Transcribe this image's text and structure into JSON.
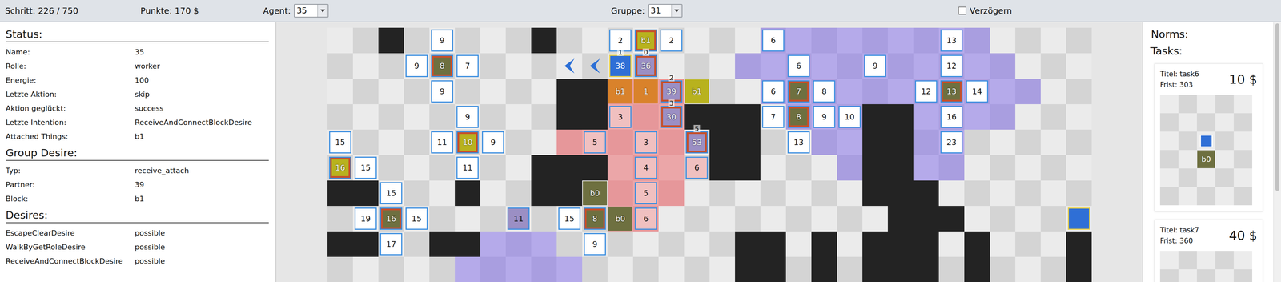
{
  "toolbar": {
    "step": "Schritt: 226 / 750",
    "points": "Punkte: 170 $",
    "agent_label": "Agent:",
    "agent_value": "35",
    "group_label": "Gruppe:",
    "group_value": "31",
    "delay": {
      "label": "Verzögern",
      "checked": false
    }
  },
  "status": {
    "title": "Status:",
    "rows": [
      {
        "label": "Name:",
        "value": "35"
      },
      {
        "label": "Rolle:",
        "value": "worker"
      },
      {
        "label": "Energie:",
        "value": "100"
      },
      {
        "label": "Letzte Aktion:",
        "value": "skip"
      },
      {
        "label": "Aktion geglückt:",
        "value": "success"
      },
      {
        "label": "Letzte Intention:",
        "value": "ReceiveAndConnectBlockDesire"
      },
      {
        "label": "Attached Things:",
        "value": "b1"
      }
    ]
  },
  "group_desire": {
    "title": "Group Desire:",
    "rows": [
      {
        "label": "Typ:",
        "value": "receive_attach"
      },
      {
        "label": "Partner:",
        "value": "39"
      },
      {
        "label": "Block:",
        "value": "b1"
      }
    ]
  },
  "desires": {
    "title": "Desires:",
    "rows": [
      {
        "label": "EscapeClearDesire",
        "value": "possible"
      },
      {
        "label": "WalkByGetRoleDesire",
        "value": "possible"
      },
      {
        "label": "ReceiveAndConnectBlockDesire",
        "value": "possible"
      }
    ]
  },
  "map": {
    "rows": [
      "..#.....#........ppppppppp....",
      "................ppppppppppp...",
      ".........##rrr...ppppppppppp..",
      ".........##rrr###.ppp##pppp...",
      ".........rrrrr.##..pp##pp.....",
      "........###rrr.##...p##pp.....",
      "##...#..##.rrr.......###......",
      "...........rr.........###.....",
      "##..##ppp.......##.#.###.#...#",
      ".....ppppp......##.#.###.#...#"
    ],
    "entities": [
      {
        "row": 0,
        "col": 4,
        "label": "9",
        "kind": "agent",
        "color": "#ffffff",
        "tag": ""
      },
      {
        "row": 0,
        "col": 11,
        "label": "2",
        "kind": "agent",
        "color": "#ffffff",
        "tag": ""
      },
      {
        "row": 0,
        "col": 12,
        "label": "b1",
        "kind": "carrier",
        "color": "#b8b21e",
        "tag": ""
      },
      {
        "row": 0,
        "col": 13,
        "label": "2",
        "kind": "agent",
        "color": "#ffffff",
        "tag": ""
      },
      {
        "row": 0,
        "col": 17,
        "label": "6",
        "kind": "agent",
        "color": "#ffffff",
        "tag": ""
      },
      {
        "row": 0,
        "col": 24,
        "label": "13",
        "kind": "agent",
        "color": "#ffffff",
        "tag": ""
      },
      {
        "row": 1,
        "col": 3,
        "label": "9",
        "kind": "agent",
        "color": "#ffffff",
        "tag": ""
      },
      {
        "row": 1,
        "col": 4,
        "label": "8",
        "kind": "carrier",
        "color": "#6e7040",
        "tag": ""
      },
      {
        "row": 1,
        "col": 5,
        "label": "7",
        "kind": "agent",
        "color": "#ffffff",
        "tag": ""
      },
      {
        "row": 1,
        "col": 9,
        "label": "",
        "kind": "arrow",
        "color": "#2b6fd6",
        "tag": ""
      },
      {
        "row": 1,
        "col": 10,
        "label": "",
        "kind": "arrow",
        "color": "#2b6fd6",
        "tag": ""
      },
      {
        "row": 1,
        "col": 11,
        "label": "38",
        "kind": "selected",
        "color": "#2f6fd6",
        "tag": "1"
      },
      {
        "row": 1,
        "col": 12,
        "label": "36",
        "kind": "carrier",
        "color": "#9b8fc4",
        "tag": "0"
      },
      {
        "row": 1,
        "col": 18,
        "label": "6",
        "kind": "agent",
        "color": "#ffffff",
        "tag": ""
      },
      {
        "row": 1,
        "col": 21,
        "label": "9",
        "kind": "agent",
        "color": "#ffffff",
        "tag": ""
      },
      {
        "row": 1,
        "col": 24,
        "label": "12",
        "kind": "agent",
        "color": "#ffffff",
        "tag": ""
      },
      {
        "row": 2,
        "col": 4,
        "label": "9",
        "kind": "agent",
        "color": "#ffffff",
        "tag": ""
      },
      {
        "row": 2,
        "col": 11,
        "label": "b1",
        "kind": "block",
        "color": "#d9822b",
        "tag": ""
      },
      {
        "row": 2,
        "col": 12,
        "label": "1",
        "kind": "block",
        "color": "#d9822b",
        "tag": ""
      },
      {
        "row": 2,
        "col": 13,
        "label": "39",
        "kind": "carrier",
        "color": "#9b8fc4",
        "tag": "2"
      },
      {
        "row": 2,
        "col": 14,
        "label": "b1",
        "kind": "block",
        "color": "#b8b21e",
        "tag": ""
      },
      {
        "row": 2,
        "col": 17,
        "label": "6",
        "kind": "agent",
        "color": "#ffffff",
        "tag": ""
      },
      {
        "row": 2,
        "col": 18,
        "label": "7",
        "kind": "carrier",
        "color": "#6e7040",
        "tag": ""
      },
      {
        "row": 2,
        "col": 19,
        "label": "8",
        "kind": "agent",
        "color": "#ffffff",
        "tag": ""
      },
      {
        "row": 2,
        "col": 23,
        "label": "12",
        "kind": "agent",
        "color": "#ffffff",
        "tag": ""
      },
      {
        "row": 2,
        "col": 24,
        "label": "13",
        "kind": "carrier",
        "color": "#6e7040",
        "tag": ""
      },
      {
        "row": 2,
        "col": 25,
        "label": "14",
        "kind": "agent",
        "color": "#ffffff",
        "tag": ""
      },
      {
        "row": 3,
        "col": 5,
        "label": "9",
        "kind": "agent",
        "color": "#ffffff",
        "tag": ""
      },
      {
        "row": 3,
        "col": 11,
        "label": "3",
        "kind": "agent",
        "color": "#f0c0c0",
        "tag": ""
      },
      {
        "row": 3,
        "col": 13,
        "label": "30",
        "kind": "carrier",
        "color": "#9b8fc4",
        "tag": "3"
      },
      {
        "row": 3,
        "col": 17,
        "label": "7",
        "kind": "agent",
        "color": "#ffffff",
        "tag": ""
      },
      {
        "row": 3,
        "col": 18,
        "label": "8",
        "kind": "carrier",
        "color": "#6e7040",
        "tag": ""
      },
      {
        "row": 3,
        "col": 19,
        "label": "9",
        "kind": "agent",
        "color": "#ffffff",
        "tag": ""
      },
      {
        "row": 3,
        "col": 20,
        "label": "10",
        "kind": "agent",
        "color": "#ffffff",
        "tag": ""
      },
      {
        "row": 3,
        "col": 24,
        "label": "16",
        "kind": "agent",
        "color": "#ffffff",
        "tag": ""
      },
      {
        "row": 4,
        "col": 0,
        "label": "15",
        "kind": "agent",
        "color": "#ffffff",
        "tag": ""
      },
      {
        "row": 4,
        "col": 4,
        "label": "11",
        "kind": "agent",
        "color": "#ffffff",
        "tag": ""
      },
      {
        "row": 4,
        "col": 5,
        "label": "10",
        "kind": "carrier",
        "color": "#b8b21e",
        "tag": ""
      },
      {
        "row": 4,
        "col": 6,
        "label": "9",
        "kind": "agent",
        "color": "#ffffff",
        "tag": ""
      },
      {
        "row": 4,
        "col": 10,
        "label": "5",
        "kind": "agent",
        "color": "#f0c0c0",
        "tag": ""
      },
      {
        "row": 4,
        "col": 12,
        "label": "3",
        "kind": "agent",
        "color": "#f0c0c0",
        "tag": ""
      },
      {
        "row": 4,
        "col": 14,
        "label": "53",
        "kind": "carrier",
        "color": "#9b8fc4",
        "tag": "5"
      },
      {
        "row": 4,
        "col": 18,
        "label": "13",
        "kind": "agent",
        "color": "#ffffff",
        "tag": ""
      },
      {
        "row": 4,
        "col": 24,
        "label": "23",
        "kind": "agent",
        "color": "#ffffff",
        "tag": ""
      },
      {
        "row": 5,
        "col": 0,
        "label": "16",
        "kind": "carrier",
        "color": "#b8b21e",
        "tag": ""
      },
      {
        "row": 5,
        "col": 1,
        "label": "15",
        "kind": "agent",
        "color": "#ffffff",
        "tag": ""
      },
      {
        "row": 5,
        "col": 5,
        "label": "11",
        "kind": "agent",
        "color": "#ffffff",
        "tag": ""
      },
      {
        "row": 5,
        "col": 12,
        "label": "4",
        "kind": "agent",
        "color": "#f0c0c0",
        "tag": ""
      },
      {
        "row": 5,
        "col": 14,
        "label": "6",
        "kind": "agent",
        "color": "#f0c0c0",
        "tag": ""
      },
      {
        "row": 6,
        "col": 2,
        "label": "15",
        "kind": "agent",
        "color": "#ffffff",
        "tag": ""
      },
      {
        "row": 6,
        "col": 10,
        "label": "b0",
        "kind": "block",
        "color": "#6e7040",
        "tag": ""
      },
      {
        "row": 6,
        "col": 12,
        "label": "5",
        "kind": "agent",
        "color": "#f0c0c0",
        "tag": ""
      },
      {
        "row": 7,
        "col": 1,
        "label": "19",
        "kind": "agent",
        "color": "#ffffff",
        "tag": ""
      },
      {
        "row": 7,
        "col": 2,
        "label": "16",
        "kind": "carrier",
        "color": "#6e7040",
        "tag": ""
      },
      {
        "row": 7,
        "col": 3,
        "label": "15",
        "kind": "agent",
        "color": "#ffffff",
        "tag": ""
      },
      {
        "row": 7,
        "col": 7,
        "label": "11",
        "kind": "agent",
        "color": "#9b8fc4",
        "tag": ""
      },
      {
        "row": 7,
        "col": 9,
        "label": "15",
        "kind": "agent",
        "color": "#ffffff",
        "tag": ""
      },
      {
        "row": 7,
        "col": 10,
        "label": "8",
        "kind": "carrier",
        "color": "#6e7040",
        "tag": ""
      },
      {
        "row": 7,
        "col": 11,
        "label": "b0",
        "kind": "block",
        "color": "#6e7040",
        "tag": ""
      },
      {
        "row": 7,
        "col": 12,
        "label": "6",
        "kind": "agent",
        "color": "#f0c0c0",
        "tag": ""
      },
      {
        "row": 7,
        "col": 29,
        "label": "",
        "kind": "selected",
        "color": "#2f6fd6",
        "tag": ""
      },
      {
        "row": 8,
        "col": 2,
        "label": "17",
        "kind": "agent",
        "color": "#ffffff",
        "tag": ""
      },
      {
        "row": 8,
        "col": 10,
        "label": "9",
        "kind": "agent",
        "color": "#ffffff",
        "tag": ""
      }
    ]
  },
  "norms": {
    "title": "Norms:"
  },
  "tasks": {
    "title": "Tasks:",
    "items": [
      {
        "title_label": "Titel:",
        "title": "task6",
        "deadline_label": "Frist:",
        "deadline": "303",
        "reward": "10 $",
        "pattern": [
          {
            "row": 2,
            "col": 2,
            "kind": "agent",
            "label": ""
          },
          {
            "row": 3,
            "col": 2,
            "kind": "block",
            "label": "b0"
          }
        ]
      },
      {
        "title_label": "Titel:",
        "title": "task7",
        "deadline_label": "Frist:",
        "deadline": "360",
        "reward": "40 $",
        "pattern": []
      }
    ]
  }
}
